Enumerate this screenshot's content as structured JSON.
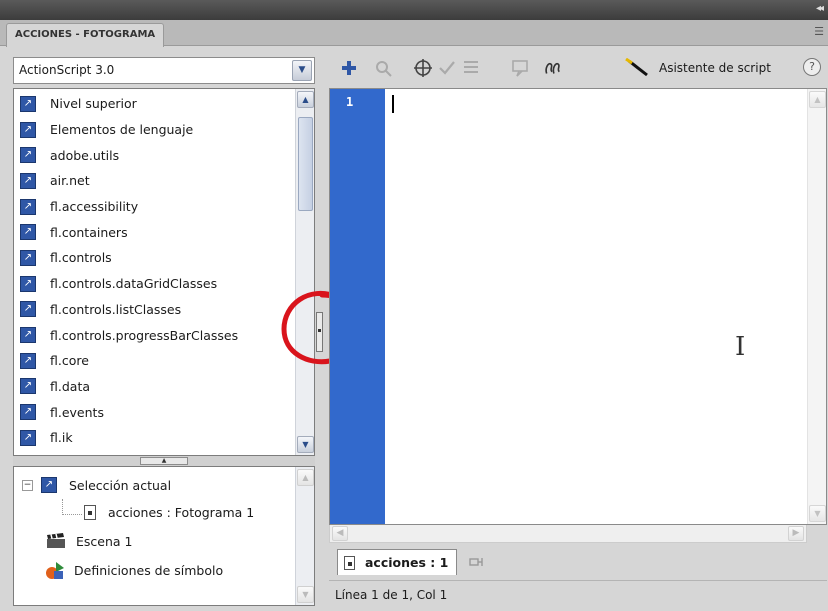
{
  "panel": {
    "title": "ACCIONES - FOTOGRAMA"
  },
  "language_select": {
    "value": "ActionScript 3.0"
  },
  "actions_toolbox": {
    "items": [
      "Nivel superior",
      "Elementos de lenguaje",
      "adobe.utils",
      "air.net",
      "fl.accessibility",
      "fl.containers",
      "fl.controls",
      "fl.controls.dataGridClasses",
      "fl.controls.listClasses",
      "fl.controls.progressBarClasses",
      "fl.core",
      "fl.data",
      "fl.events",
      "fl.ik"
    ]
  },
  "script_navigator": {
    "current_selection": "Selección actual",
    "frame_entry": "acciones : Fotograma 1",
    "scene": "Escena 1",
    "symbol_definitions": "Definiciones de símbolo"
  },
  "toolbar": {
    "script_assist_label": "Asistente de script",
    "icons": [
      "add-item-icon",
      "find-icon",
      "target-path-icon",
      "check-syntax-icon",
      "auto-format-icon",
      "show-code-hint-icon",
      "debug-options-icon"
    ]
  },
  "editor": {
    "line_number": "1"
  },
  "script_tab": {
    "label": "acciones : 1"
  },
  "status": {
    "text": "Línea 1 de 1, Col 1"
  },
  "colors": {
    "gutter": "#3269cc",
    "highlight_ring": "#d9141c",
    "book_icon": "#2f57a6"
  }
}
